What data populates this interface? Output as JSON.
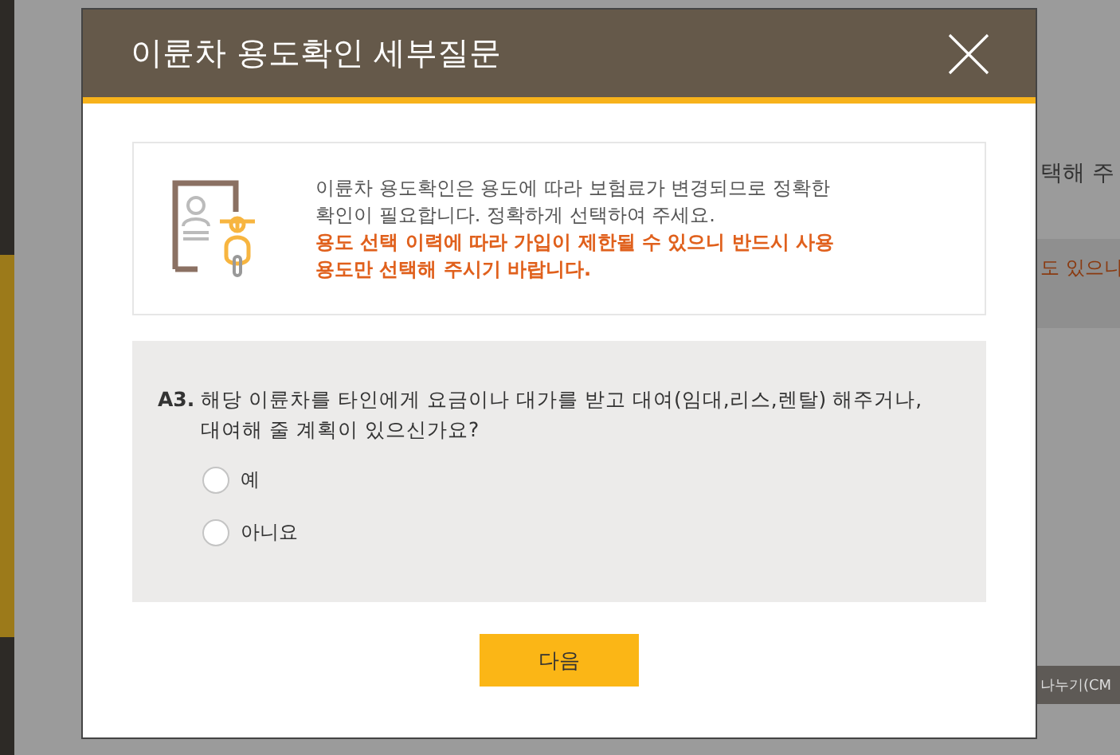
{
  "background": {
    "texts": [
      "택해 주",
      "도 있으니",
      "나누기(CM"
    ]
  },
  "dialog": {
    "title": "이륜차 용도확인 세부질문",
    "notice": {
      "text": "이륜차 용도확인은 용도에 따라 보험료가 변경되므로 정확한 확인이 필요합니다. 정확하게 선택하여 주세요.",
      "warning": "용도 선택 이력에 따라 가입이 제한될 수 있으니 반드시 사용 용도만 선택해 주시기 바랍니다."
    },
    "question": {
      "number": "A3.",
      "text": "해당 이륜차를 타인에게 요금이나 대가를 받고 대여(임대,리스,렌탈) 해주거나, 대여해 줄 계획이 있으신가요?",
      "options": [
        {
          "label": "예",
          "selected": false
        },
        {
          "label": "아니요",
          "selected": false
        }
      ]
    },
    "button": "다음"
  }
}
